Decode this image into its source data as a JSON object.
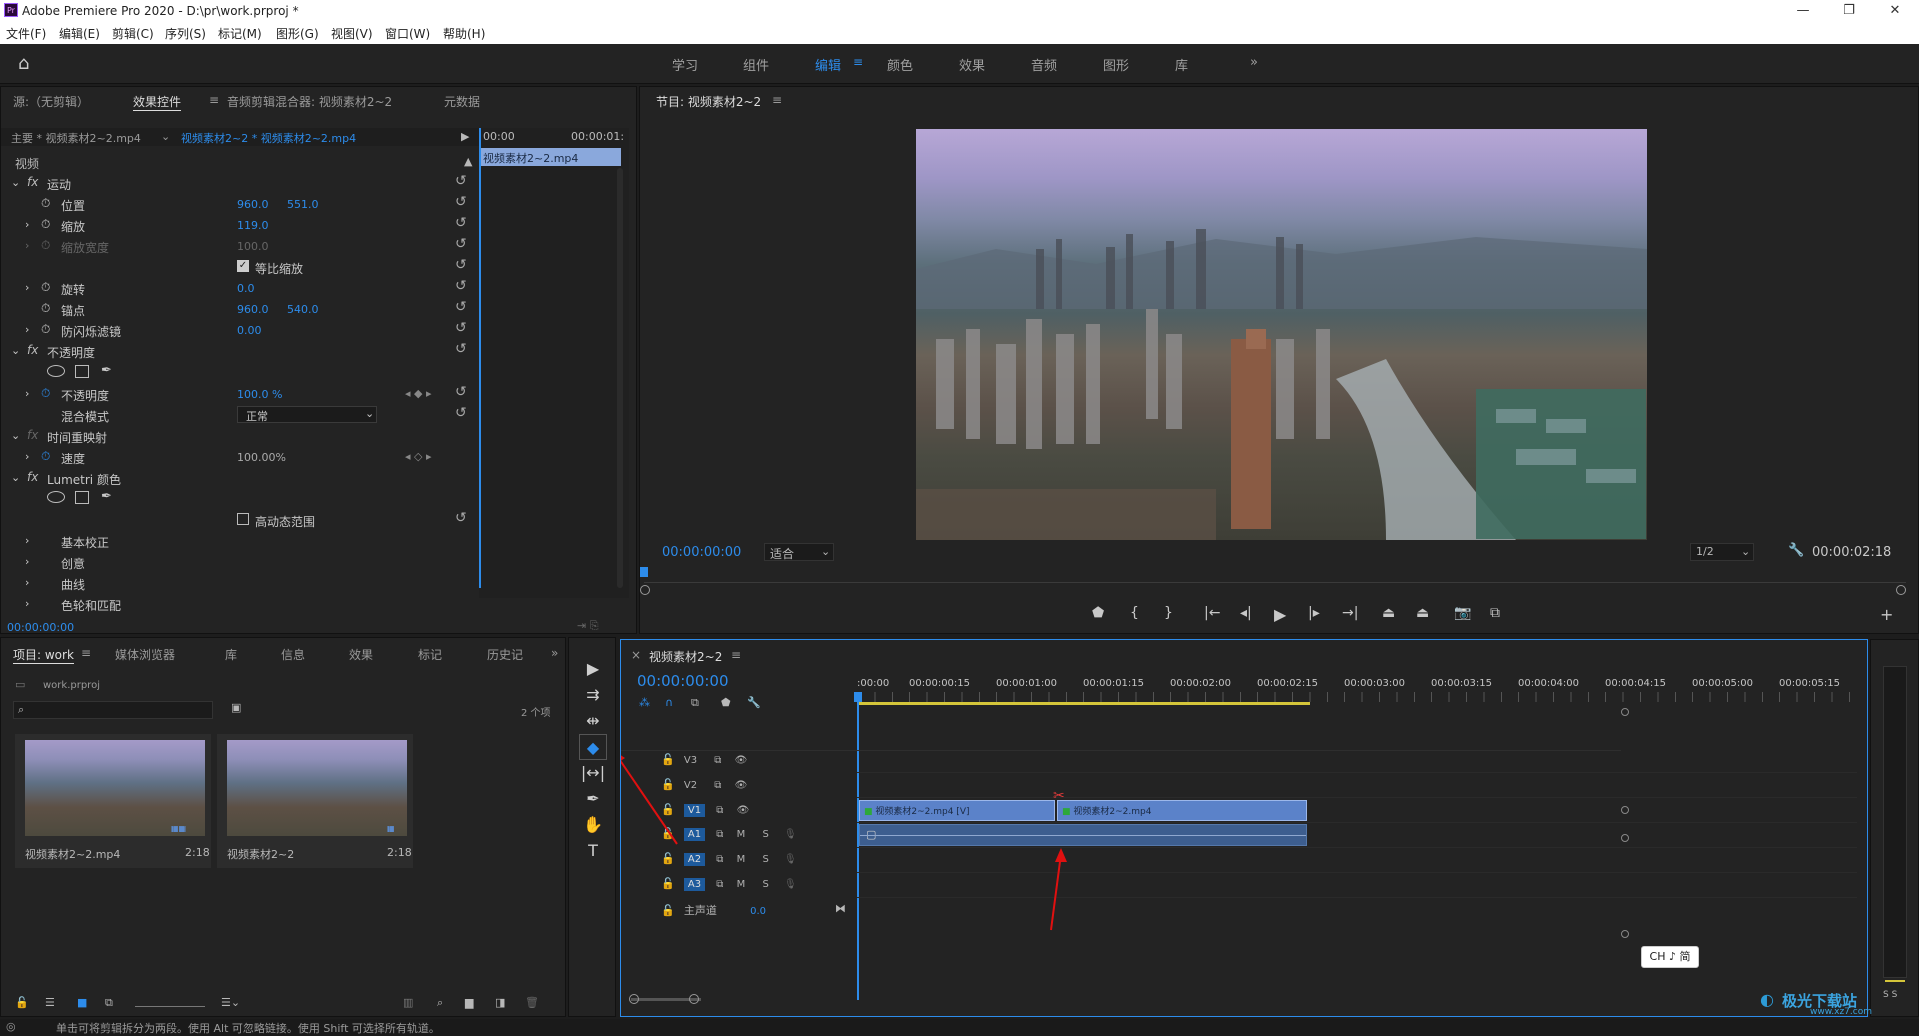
{
  "app": {
    "title": "Adobe Premiere Pro 2020 - D:\\pr\\work.prproj *",
    "logo": "Pr"
  },
  "window_controls": {
    "minimize": "—",
    "maximize": "❐",
    "close": "✕"
  },
  "menu": [
    "文件(F)",
    "编辑(E)",
    "剪辑(C)",
    "序列(S)",
    "标记(M)",
    "图形(G)",
    "视图(V)",
    "窗口(W)",
    "帮助(H)"
  ],
  "workspaces": {
    "items": [
      "学习",
      "组件",
      "编辑",
      "颜色",
      "效果",
      "音频",
      "图形",
      "库"
    ],
    "active": "编辑",
    "more": "»"
  },
  "effect_panel": {
    "tabs": [
      "源:（无剪辑）",
      "效果控件",
      "音频剪辑混合器: 视频素材2~2",
      "元数据"
    ],
    "active_tab": "效果控件",
    "master_label": "主要 * 视频素材2~2.mp4",
    "clip_label": "视频素材2~2 * 视频素材2~2.mp4",
    "ruler_start": "00:00",
    "ruler_end": "00:00:01:",
    "clip_bar": "视频素材2~2.mp4",
    "section_video": "视频",
    "motion": "运动",
    "position": {
      "label": "位置",
      "x": "960.0",
      "y": "551.0"
    },
    "scale": {
      "label": "缩放",
      "value": "119.0"
    },
    "scale_width": {
      "label": "缩放宽度",
      "value": "100.0"
    },
    "uniform": "等比缩放",
    "rotation": {
      "label": "旋转",
      "value": "0.0"
    },
    "anchor": {
      "label": "锚点",
      "x": "960.0",
      "y": "540.0"
    },
    "antiflicker": {
      "label": "防闪烁滤镜",
      "value": "0.00"
    },
    "opacity_group": "不透明度",
    "opacity": {
      "label": "不透明度",
      "value": "100.0 %"
    },
    "blend": {
      "label": "混合模式",
      "value": "正常"
    },
    "time_remap": "时间重映射",
    "speed": {
      "label": "速度",
      "value": "100.00%"
    },
    "lumetri": "Lumetri 颜色",
    "hdr": "高动态范围",
    "basic": "基本校正",
    "creative": "创意",
    "curves": "曲线",
    "wheels": "色轮和匹配",
    "timecode": "00:00:00:00"
  },
  "program": {
    "title": "节目: 视频素材2~2",
    "timecode": "00:00:00:00",
    "fit": "适合",
    "quality": "1/2",
    "duration": "00:00:02:18"
  },
  "project": {
    "tabs": [
      "项目: work",
      "媒体浏览器",
      "库",
      "信息",
      "效果",
      "标记",
      "历史记"
    ],
    "active_tab": "项目: work",
    "file": "work.prproj",
    "count": "2 个项",
    "items": [
      {
        "name": "视频素材2~2.mp4",
        "dur": "2:18"
      },
      {
        "name": "视频素材2~2",
        "dur": "2:18"
      }
    ]
  },
  "timeline": {
    "title": "视频素材2~2",
    "timecode": "00:00:00:00",
    "ruler": [
      ":00:00",
      "00:00:00:15",
      "00:00:01:00",
      "00:00:01:15",
      "00:00:02:00",
      "00:00:02:15",
      "00:00:03:00",
      "00:00:03:15",
      "00:00:04:00",
      "00:00:04:15",
      "00:00:05:00",
      "00:00:05:15"
    ],
    "video_tracks": [
      "V3",
      "V2",
      "V1"
    ],
    "audio_tracks": [
      "A1",
      "A2",
      "A3"
    ],
    "mute": "M",
    "solo": "S",
    "master": {
      "label": "主声道",
      "value": "0.0"
    },
    "clip1": "视频素材2~2.mp4 [V]",
    "clip2": "视频素材2~2.mp4"
  },
  "ime": "CH ♪ 简",
  "watermark": {
    "text": "极光下载站",
    "url": "www.xz7.com"
  },
  "audio_meter": {
    "labels": "S S"
  },
  "status": "单击可将剪辑拆分为两段。使用 Alt 可忽略链接。使用 Shift 可选择所有轨道。"
}
